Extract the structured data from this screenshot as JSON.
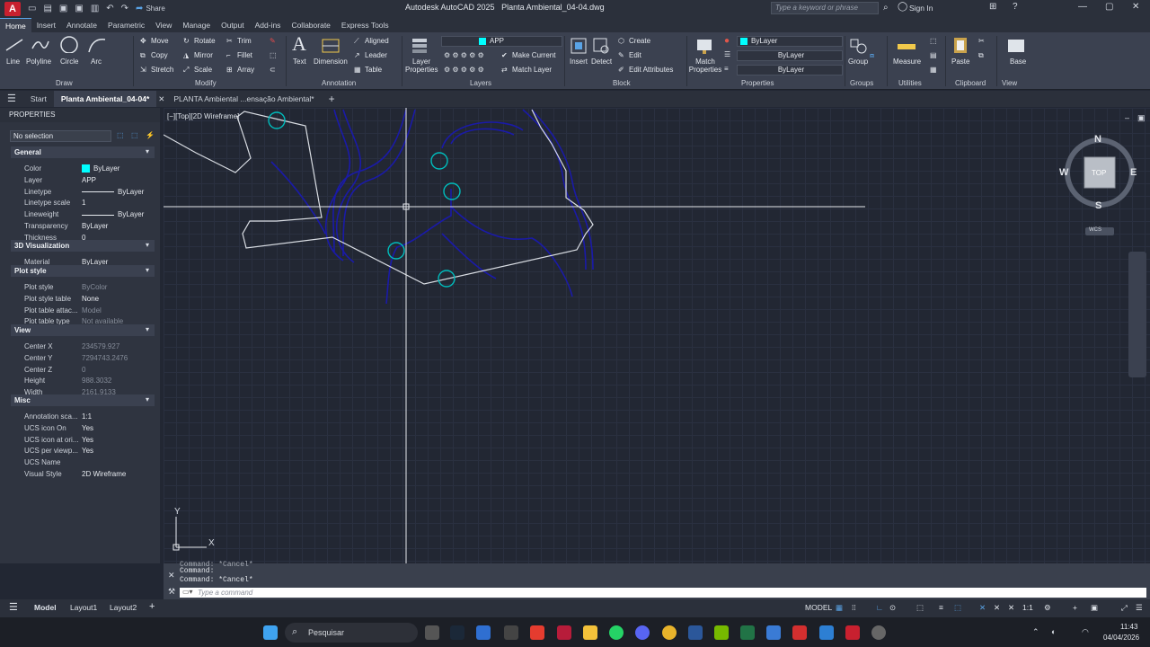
{
  "titlebar": {
    "app_logo": "A",
    "app_name": "Autodesk AutoCAD 2025",
    "file_name": "Planta Ambiental_04-04.dwg",
    "share_label": "Share",
    "search_placeholder": "Type a keyword or phrase",
    "sign_in": "Sign In"
  },
  "ribbon_tabs": [
    "Home",
    "Insert",
    "Annotate",
    "Parametric",
    "View",
    "Manage",
    "Output",
    "Add-ins",
    "Collaborate",
    "Express Tools"
  ],
  "draw": {
    "line": "Line",
    "polyline": "Polyline",
    "circle": "Circle",
    "arc": "Arc",
    "title": "Draw"
  },
  "modify": {
    "move": "Move",
    "rotate": "Rotate",
    "trim": "Trim",
    "copy": "Copy",
    "mirror": "Mirror",
    "fillet": "Fillet",
    "stretch": "Stretch",
    "scale": "Scale",
    "array": "Array",
    "title": "Modify"
  },
  "annotation": {
    "text": "Text",
    "dimension": "Dimension",
    "aligned": "Aligned",
    "leader": "Leader",
    "table": "Table",
    "title": "Annotation"
  },
  "layers": {
    "layer_properties": "Layer Properties",
    "current_layer": "APP",
    "make_current": "Make Current",
    "match_layer": "Match Layer",
    "title": "Layers"
  },
  "block": {
    "insert": "Insert",
    "detect": "Detect",
    "create": "Create",
    "edit": "Edit",
    "edit_attributes": "Edit Attributes",
    "title": "Block"
  },
  "properties_panel": {
    "match_properties": "Match Properties",
    "color": "ByLayer",
    "linetype": "ByLayer",
    "lineweight": "ByLayer",
    "title": "Properties"
  },
  "groups": {
    "group": "Group",
    "title": "Groups"
  },
  "utilities": {
    "measure": "Measure",
    "title": "Utilities"
  },
  "clipboard": {
    "paste": "Paste",
    "title": "Clipboard"
  },
  "view_panel": {
    "base": "Base",
    "title": "View"
  },
  "doc_tabs": [
    "Start",
    "Planta Ambiental_04-04*",
    "PLANTA Ambiental ...ensação Ambiental*"
  ],
  "props": {
    "header": "PROPERTIES",
    "selection": "No selection",
    "sections": {
      "general": "General",
      "viz": "3D Visualization",
      "plot": "Plot style",
      "view": "View",
      "misc": "Misc"
    },
    "general": [
      [
        "Color",
        "ByLayer"
      ],
      [
        "Layer",
        "APP"
      ],
      [
        "Linetype",
        "ByLayer"
      ],
      [
        "Linetype scale",
        "1"
      ],
      [
        "Lineweight",
        "ByLayer"
      ],
      [
        "Transparency",
        "ByLayer"
      ],
      [
        "Thickness",
        "0"
      ]
    ],
    "viz": [
      [
        "Material",
        "ByLayer"
      ]
    ],
    "plot": [
      [
        "Plot style",
        "ByColor"
      ],
      [
        "Plot style table",
        "None"
      ],
      [
        "Plot table attac...",
        "Model"
      ],
      [
        "Plot table type",
        "Not available"
      ]
    ],
    "view": [
      [
        "Center X",
        "234579.927"
      ],
      [
        "Center Y",
        "7294743.2476"
      ],
      [
        "Center Z",
        "0"
      ],
      [
        "Height",
        "988.3032"
      ],
      [
        "Width",
        "2161.9133"
      ]
    ],
    "misc": [
      [
        "Annotation sca...",
        "1:1"
      ],
      [
        "UCS icon On",
        "Yes"
      ],
      [
        "UCS icon at ori...",
        "Yes"
      ],
      [
        "UCS per viewp...",
        "Yes"
      ],
      [
        "UCS Name",
        ""
      ],
      [
        "Visual Style",
        "2D Wireframe"
      ]
    ]
  },
  "viewport": {
    "label": "[−][Top][2D Wireframe]",
    "viewcube": {
      "n": "N",
      "s": "S",
      "e": "E",
      "w": "W",
      "top": "TOP",
      "wcs": "WCS"
    },
    "ucs_x": "X",
    "ucs_y": "Y"
  },
  "command": {
    "line1": "Command: *Cancel*",
    "line2": "Command:",
    "line3": "Command: *Cancel*",
    "placeholder": "Type a command"
  },
  "status": {
    "model_tab": "Model",
    "layout1": "Layout1",
    "layout2": "Layout2",
    "model_btn": "MODEL",
    "scale": "1:1"
  },
  "taskbar": {
    "search": "Pesquisar",
    "time": "11:43",
    "date": "04/04/2026"
  },
  "colors": {
    "cyan": "#00ffff",
    "blue": "#1a1aa8",
    "white": "#d9dde3",
    "accent": "#59a3e6"
  }
}
